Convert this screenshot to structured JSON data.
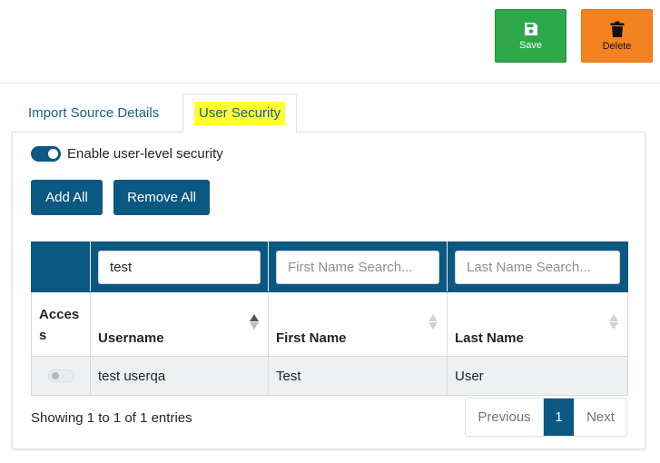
{
  "toolbar": {
    "save_label": "Save",
    "delete_label": "Delete",
    "save_color": "#2ea84a",
    "delete_color": "#f58220"
  },
  "tabs": [
    {
      "label": "Import Source Details",
      "active": false
    },
    {
      "label": "User Security",
      "active": true
    }
  ],
  "security": {
    "toggle_label": "Enable user-level security",
    "toggle_on": true,
    "add_all_label": "Add All",
    "remove_all_label": "Remove All"
  },
  "table": {
    "search": {
      "username_value": "test",
      "first_name_placeholder": "First Name Search...",
      "last_name_placeholder": "Last Name Search..."
    },
    "columns": [
      "Access",
      "Username",
      "First Name",
      "Last Name"
    ],
    "rows": [
      {
        "access": false,
        "username": "test userqa",
        "first_name": "Test",
        "last_name": "User"
      }
    ]
  },
  "footer": {
    "info": "Showing 1 to 1 of 1 entries",
    "previous_label": "Previous",
    "current_page": "1",
    "next_label": "Next"
  },
  "accent_color": "#0b5882",
  "highlight_color": "#ffff33"
}
